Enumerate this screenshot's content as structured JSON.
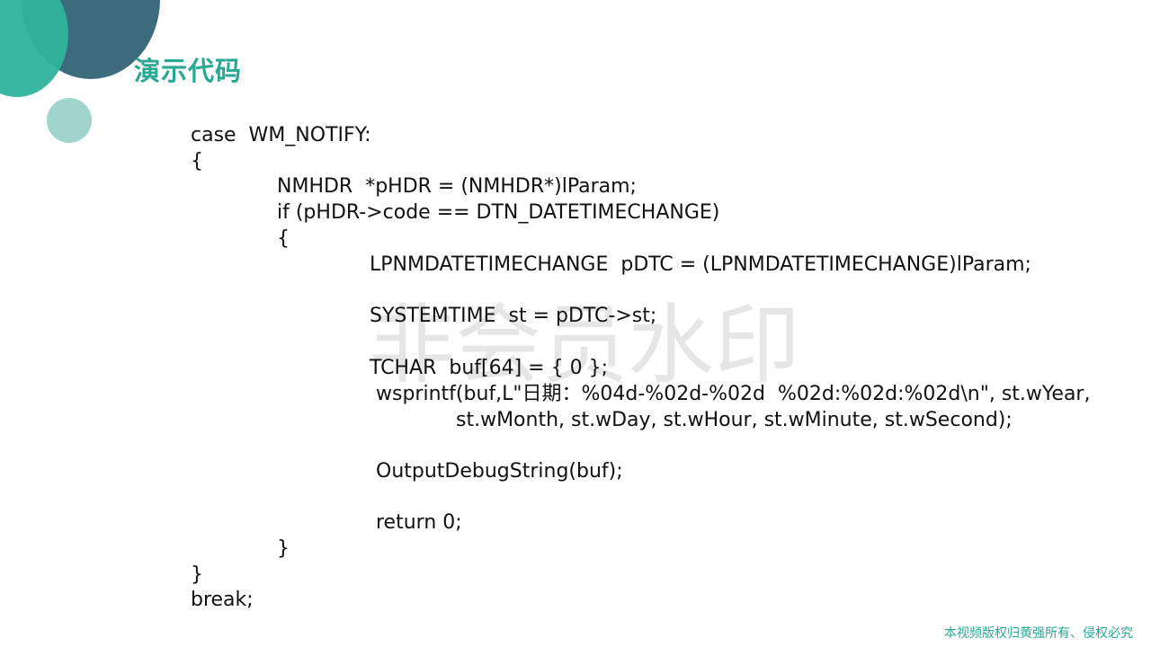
{
  "colors": {
    "accent_teal": "#2fb39b",
    "dark_teal": "#3c6b7c",
    "light_teal": "#9fd5cc",
    "title_teal": "#2aa992"
  },
  "slide": {
    "title": "演示代码",
    "watermark": "非会员水印",
    "copyright": "本视频版权归黄强所有、侵权必究"
  },
  "code": {
    "lines": [
      "case  WM_NOTIFY:",
      "{",
      "NMHDR  *pHDR = (NMHDR*)lParam;",
      "if (pHDR->code == DTN_DATETIMECHANGE)",
      "{",
      "LPNMDATETIMECHANGE  pDTC = (LPNMDATETIMECHANGE)lParam;",
      "SYSTEMTIME  st = pDTC->st;",
      "TCHAR  buf[64] = { 0 };",
      "wsprintf(buf,L\"日期：%04d-%02d-%02d  %02d:%02d:%02d\\n\", st.wYear,",
      "st.wMonth, st.wDay, st.wHour, st.wMinute, st.wSecond);",
      "OutputDebugString(buf);",
      "return 0;",
      "}",
      "}",
      "break;"
    ]
  }
}
